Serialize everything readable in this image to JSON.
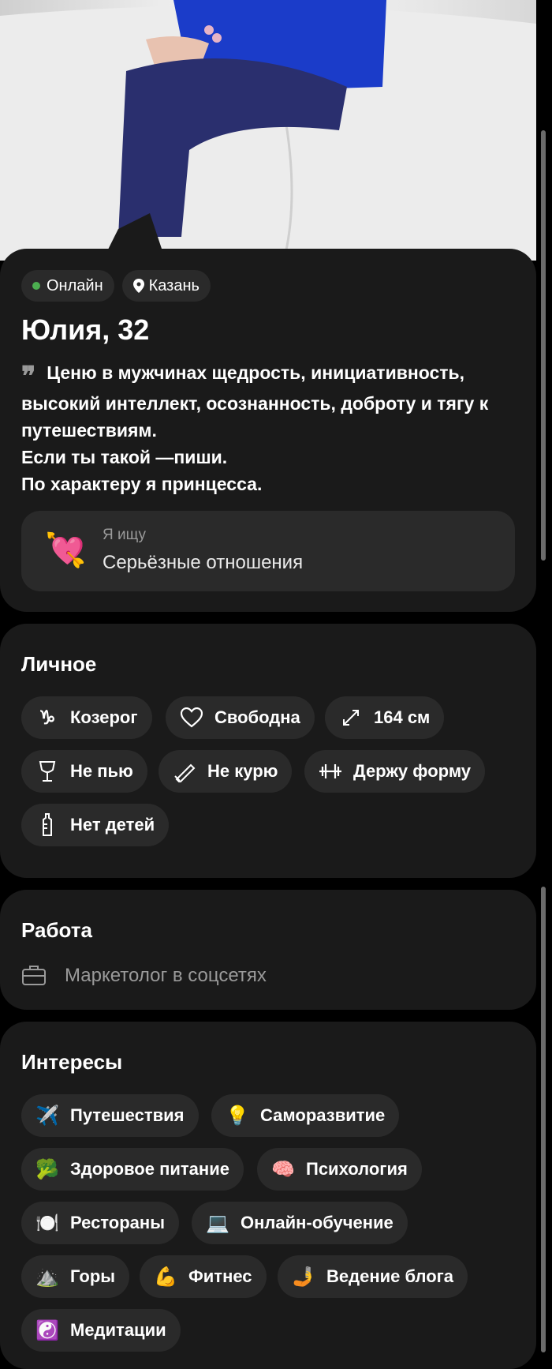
{
  "profile": {
    "status": "Онлайн",
    "city": "Казань",
    "name_age": "Юлия, 32",
    "about_lines": [
      "Ценю в мужчинах щедрость, инициативность,",
      "высокий интеллект, осознанность, доброту и тягу к",
      "путешествиям.",
      "Если ты такой —пиши.",
      "По характеру я принцесса."
    ],
    "looking_for": {
      "label": "Я ищу",
      "value": "Серьёзные отношения",
      "icon": "heart-arrow-icon"
    }
  },
  "personal": {
    "title": "Личное",
    "chips": [
      {
        "label": "Козерог",
        "icon": "capricorn-icon"
      },
      {
        "label": "Свободна",
        "icon": "heart-outline-icon"
      },
      {
        "label": "164 см",
        "icon": "expand-arrows-icon"
      },
      {
        "label": "Не пью",
        "icon": "wine-glass-icon"
      },
      {
        "label": "Не курю",
        "icon": "cigarette-icon"
      },
      {
        "label": "Держу форму",
        "icon": "dumbbell-icon"
      },
      {
        "label": "Нет детей",
        "icon": "baby-bottle-icon"
      }
    ]
  },
  "work": {
    "title": "Работа",
    "value": "Маркетолог в соцсетях",
    "icon": "briefcase-icon"
  },
  "interests": {
    "title": "Интересы",
    "items": [
      {
        "label": "Путешествия",
        "icon": "✈️"
      },
      {
        "label": "Саморазвитие",
        "icon": "💡"
      },
      {
        "label": "Здоровое питание",
        "icon": "🥦"
      },
      {
        "label": "Психология",
        "icon": "🧠"
      },
      {
        "label": "Рестораны",
        "icon": "🍽️"
      },
      {
        "label": "Онлайн-обучение",
        "icon": "💻"
      },
      {
        "label": "Горы",
        "icon": "⛰️"
      },
      {
        "label": "Фитнес",
        "icon": "💪"
      },
      {
        "label": "Ведение блога",
        "icon": "🤳"
      },
      {
        "label": "Медитации",
        "icon": "☯️"
      }
    ]
  },
  "colors": {
    "card": "#1a1a1a",
    "chip": "#2a2a2a",
    "online": "#4caf50"
  }
}
